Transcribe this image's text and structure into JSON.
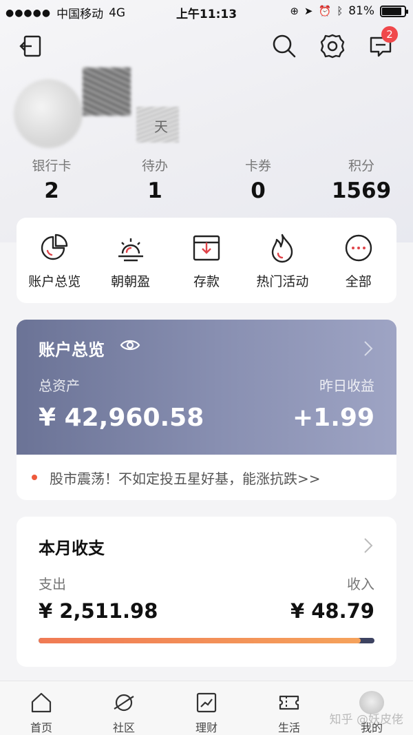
{
  "status_bar": {
    "carrier": "中国移动",
    "network": "4G",
    "time": "上午11:13",
    "battery_percent": "81%",
    "battery_level": 0.81
  },
  "header": {
    "message_badge": "2"
  },
  "profile": {
    "name_fragment": "天"
  },
  "stats": [
    {
      "label": "银行卡",
      "value": "2"
    },
    {
      "label": "待办",
      "value": "1"
    },
    {
      "label": "卡券",
      "value": "0"
    },
    {
      "label": "积分",
      "value": "1569"
    }
  ],
  "quick_actions": [
    {
      "label": "账户总览",
      "icon": "pie-chart-icon"
    },
    {
      "label": "朝朝盈",
      "icon": "sunrise-icon"
    },
    {
      "label": "存款",
      "icon": "deposit-box-icon"
    },
    {
      "label": "热门活动",
      "icon": "flame-icon"
    },
    {
      "label": "全部",
      "icon": "more-dots-icon"
    }
  ],
  "account": {
    "title": "账户总览",
    "total_label": "总资产",
    "total_value": "¥ 42,960.58",
    "yesterday_label": "昨日收益",
    "yesterday_value": "+1.99"
  },
  "promo": {
    "text": "股市震荡！不如定投五星好基，能涨抗跌>>"
  },
  "monthly": {
    "title": "本月收支",
    "expense_label": "支出",
    "expense_value": "¥ 2,511.98",
    "income_label": "收入",
    "income_value": "¥ 48.79",
    "expense_share": 0.96
  },
  "tabs": [
    {
      "label": "首页",
      "icon": "home-icon"
    },
    {
      "label": "社区",
      "icon": "planet-icon"
    },
    {
      "label": "理财",
      "icon": "trend-chart-icon"
    },
    {
      "label": "生活",
      "icon": "ticket-icon"
    },
    {
      "label": "我的",
      "icon": "avatar-icon"
    }
  ],
  "watermark": "知乎 @妖皮佬",
  "colors": {
    "badge": "#f0484b",
    "account_card_start": "#6b7396",
    "account_card_end": "#9ea4c4",
    "promo_dot": "#ee5a3c",
    "bar_expense": "#f07a54",
    "bar_income": "#3d4361"
  }
}
